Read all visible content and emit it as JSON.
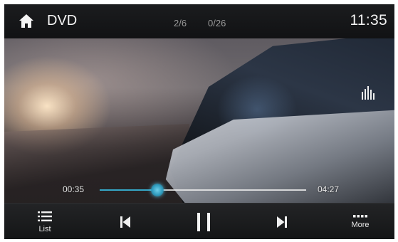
{
  "header": {
    "source_label": "DVD",
    "track": "2/6",
    "chapter": "0/26",
    "clock": "11:35"
  },
  "playback": {
    "elapsed": "00:35",
    "total": "04:27",
    "progress": 0.28
  },
  "controls": {
    "list_label": "List",
    "more_label": "More"
  },
  "colors": {
    "accent": "#35a7c8",
    "background": "#0b0b0c",
    "text": "#f2f2f2"
  },
  "icons": {
    "home": "home-icon",
    "equalizer": "equalizer-icon",
    "list": "list-icon",
    "previous": "skip-previous-icon",
    "pause": "pause-icon",
    "next": "skip-next-icon",
    "more": "more-dots-icon"
  }
}
